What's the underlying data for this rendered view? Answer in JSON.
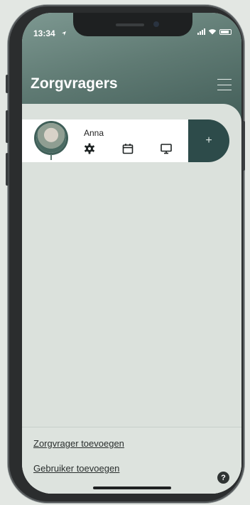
{
  "status": {
    "time": "13:34"
  },
  "header": {
    "title": "Zorgvragers"
  },
  "card": {
    "name": "Anna",
    "add_label": "+"
  },
  "footer": {
    "add_care_recipient": "Zorgvrager toevoegen",
    "add_user": "Gebruiker toevoegen",
    "help_label": "?"
  },
  "colors": {
    "accent": "#2d4b4a",
    "header_top": "#7d9891",
    "header_bottom": "#3f5a55",
    "background": "#dbe1dc"
  },
  "icons": [
    "location-arrow-icon",
    "signal-icon",
    "wifi-icon",
    "battery-icon",
    "menu-icon",
    "gear-icon",
    "calendar-icon",
    "monitor-icon",
    "help-icon"
  ]
}
